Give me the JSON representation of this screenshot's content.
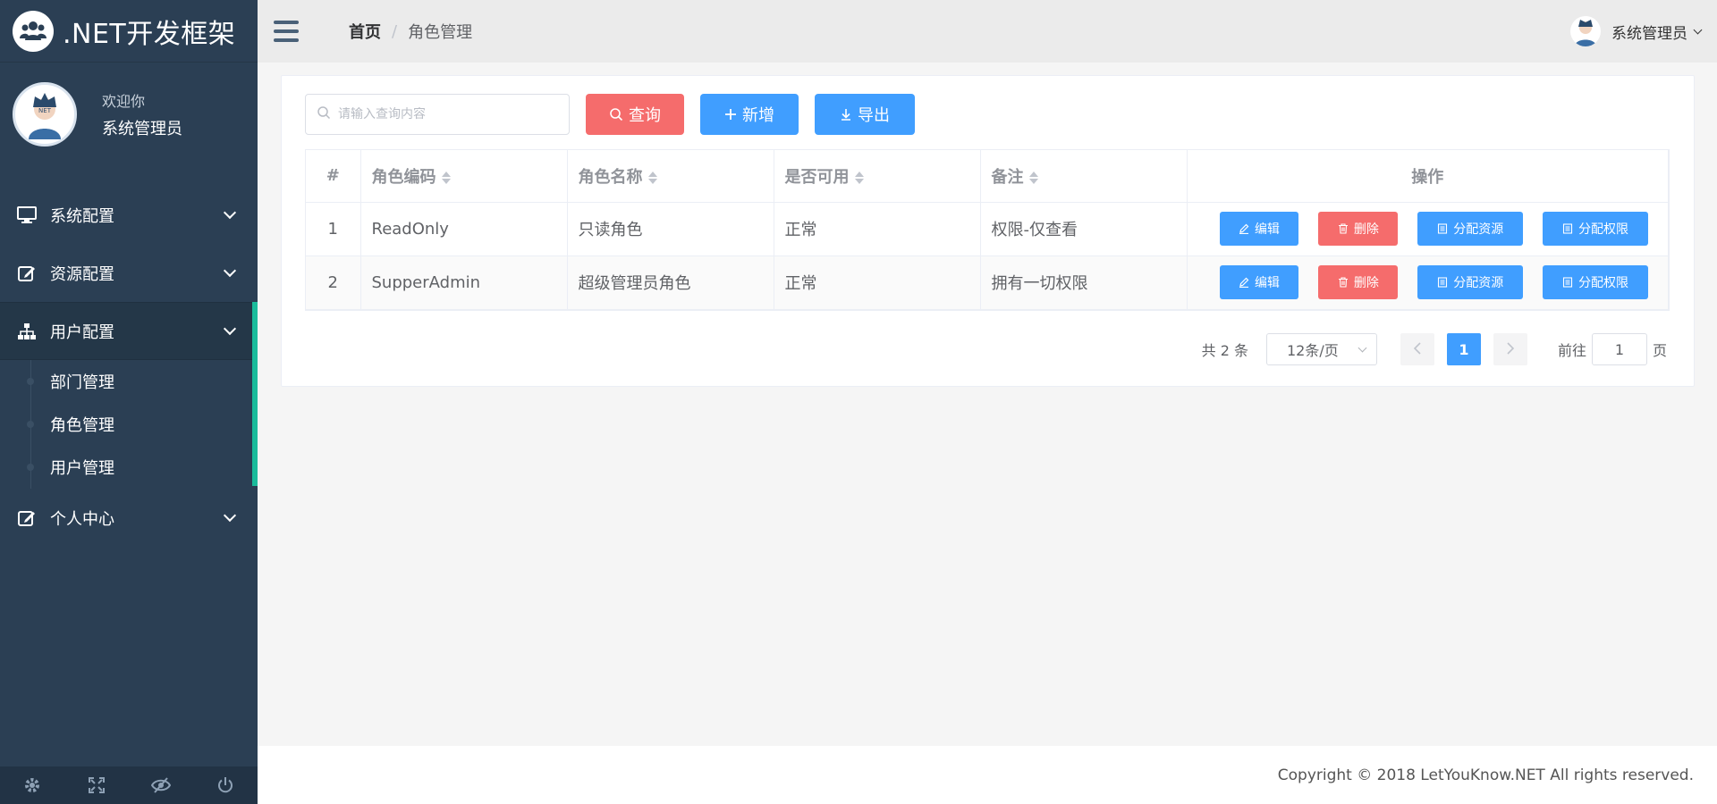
{
  "brand": {
    "title": ".NET开发框架",
    "logo_icon": "users-icon"
  },
  "user_panel": {
    "welcome": "欢迎你",
    "name": "系统管理员",
    "avatar_text": "NET"
  },
  "sidebar": {
    "items": [
      {
        "label": "系统配置",
        "icon": "monitor-icon"
      },
      {
        "label": "资源配置",
        "icon": "edit-icon"
      },
      {
        "label": "用户配置",
        "icon": "sitemap-icon",
        "expanded": true,
        "children": [
          {
            "label": "部门管理"
          },
          {
            "label": "角色管理"
          },
          {
            "label": "用户管理"
          }
        ]
      },
      {
        "label": "个人中心",
        "icon": "edit-icon"
      }
    ],
    "active_color": "#1abc9c",
    "footer_icons": [
      "gear-icon",
      "fullscreen-icon",
      "eye-slash-icon",
      "power-icon"
    ]
  },
  "header": {
    "breadcrumb": {
      "home": "首页",
      "separator": "/",
      "current": "角色管理"
    },
    "user_name": "系统管理员"
  },
  "toolbar": {
    "search_placeholder": "请输入查询内容",
    "query_label": "查询",
    "add_label": "新增",
    "export_label": "导出"
  },
  "table": {
    "columns": [
      "#",
      "角色编码",
      "角色名称",
      "是否可用",
      "备注",
      "操作"
    ],
    "rows": [
      {
        "index": "1",
        "code": "ReadOnly",
        "name": "只读角色",
        "status": "正常",
        "remark": "权限-仅查看"
      },
      {
        "index": "2",
        "code": "SupperAdmin",
        "name": "超级管理员角色",
        "status": "正常",
        "remark": "拥有一切权限"
      }
    ],
    "actions": {
      "edit": "编辑",
      "delete": "删除",
      "assign_resource": "分配资源",
      "assign_permission": "分配权限"
    }
  },
  "pagination": {
    "total_text": "共 2 条",
    "page_size": "12条/页",
    "current_page": "1",
    "goto_prefix": "前往",
    "goto_value": "1",
    "goto_suffix": "页"
  },
  "colors": {
    "primary": "#409eff",
    "danger": "#f56c6c",
    "sidebar": "#2b3f54"
  },
  "footer": {
    "copyright": "Copyright © 2018 LetYouKnow.NET All rights reserved."
  }
}
